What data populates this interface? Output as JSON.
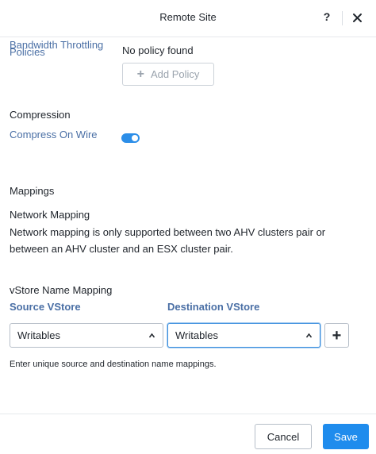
{
  "header": {
    "title": "Remote Site",
    "help_icon": "question-mark-icon",
    "close_icon": "close-icon"
  },
  "bandwidth": {
    "label_line1": "Bandwidth Throttling",
    "label_line2": "Policies",
    "status": "No policy found",
    "add_button_label": "Add Policy"
  },
  "compression": {
    "heading": "Compression",
    "option_label": "Compress On Wire",
    "enabled": true
  },
  "mappings": {
    "heading": "Mappings",
    "network": {
      "heading": "Network Mapping",
      "note_line1": "Network mapping is only supported between two AHV clusters pair or",
      "note_line2": "between an AHV cluster and an ESX cluster pair."
    },
    "vstore": {
      "heading": "vStore Name Mapping",
      "source_header": "Source VStore",
      "destination_header": "Destination VStore",
      "source_value": "Writables",
      "destination_value": "Writables",
      "add_icon": "plus-icon",
      "hint": "Enter unique source and destination name mappings."
    }
  },
  "footer": {
    "cancel_label": "Cancel",
    "save_label": "Save"
  },
  "colors": {
    "primary": "#1f8ced",
    "label_blue": "#4a6fa5",
    "toggle_on": "#2c8ee8"
  }
}
